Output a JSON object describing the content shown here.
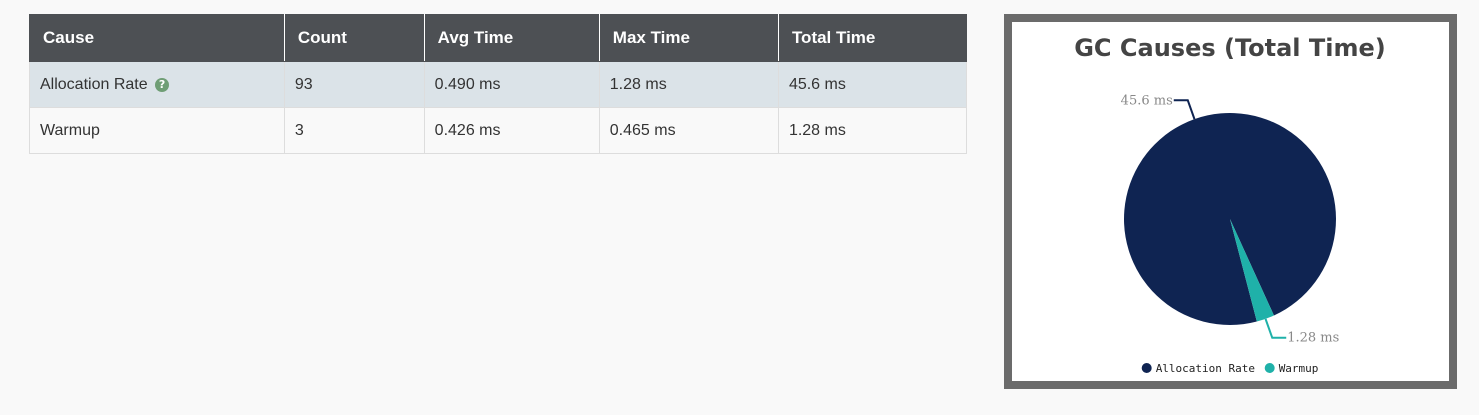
{
  "table": {
    "headers": [
      "Cause",
      "Count",
      "Avg Time",
      "Max Time",
      "Total Time"
    ],
    "rows": [
      {
        "cause": "Allocation Rate",
        "count": "93",
        "avg": "0.490 ms",
        "max": "1.28 ms",
        "total": "45.6 ms",
        "has_help": true
      },
      {
        "cause": "Warmup",
        "count": "3",
        "avg": "0.426 ms",
        "max": "0.465 ms",
        "total": "1.28 ms",
        "has_help": false
      }
    ],
    "help_icon_glyph": "?"
  },
  "colors": {
    "header_bg": "#4d5054",
    "row_highlight": "#dbe3e8",
    "help_icon": "#6f9e75",
    "series_allocation": "#0f2452",
    "series_warmup": "#1fb1a9"
  },
  "chart_data": {
    "type": "pie",
    "title": "GC Causes (Total Time)",
    "categories": [
      "Allocation Rate",
      "Warmup"
    ],
    "values": [
      45.6,
      1.28
    ],
    "labels": [
      "45.6 ms",
      "1.28 ms"
    ],
    "colors": [
      "#0f2452",
      "#1fb1a9"
    ],
    "legend": "bottom"
  }
}
